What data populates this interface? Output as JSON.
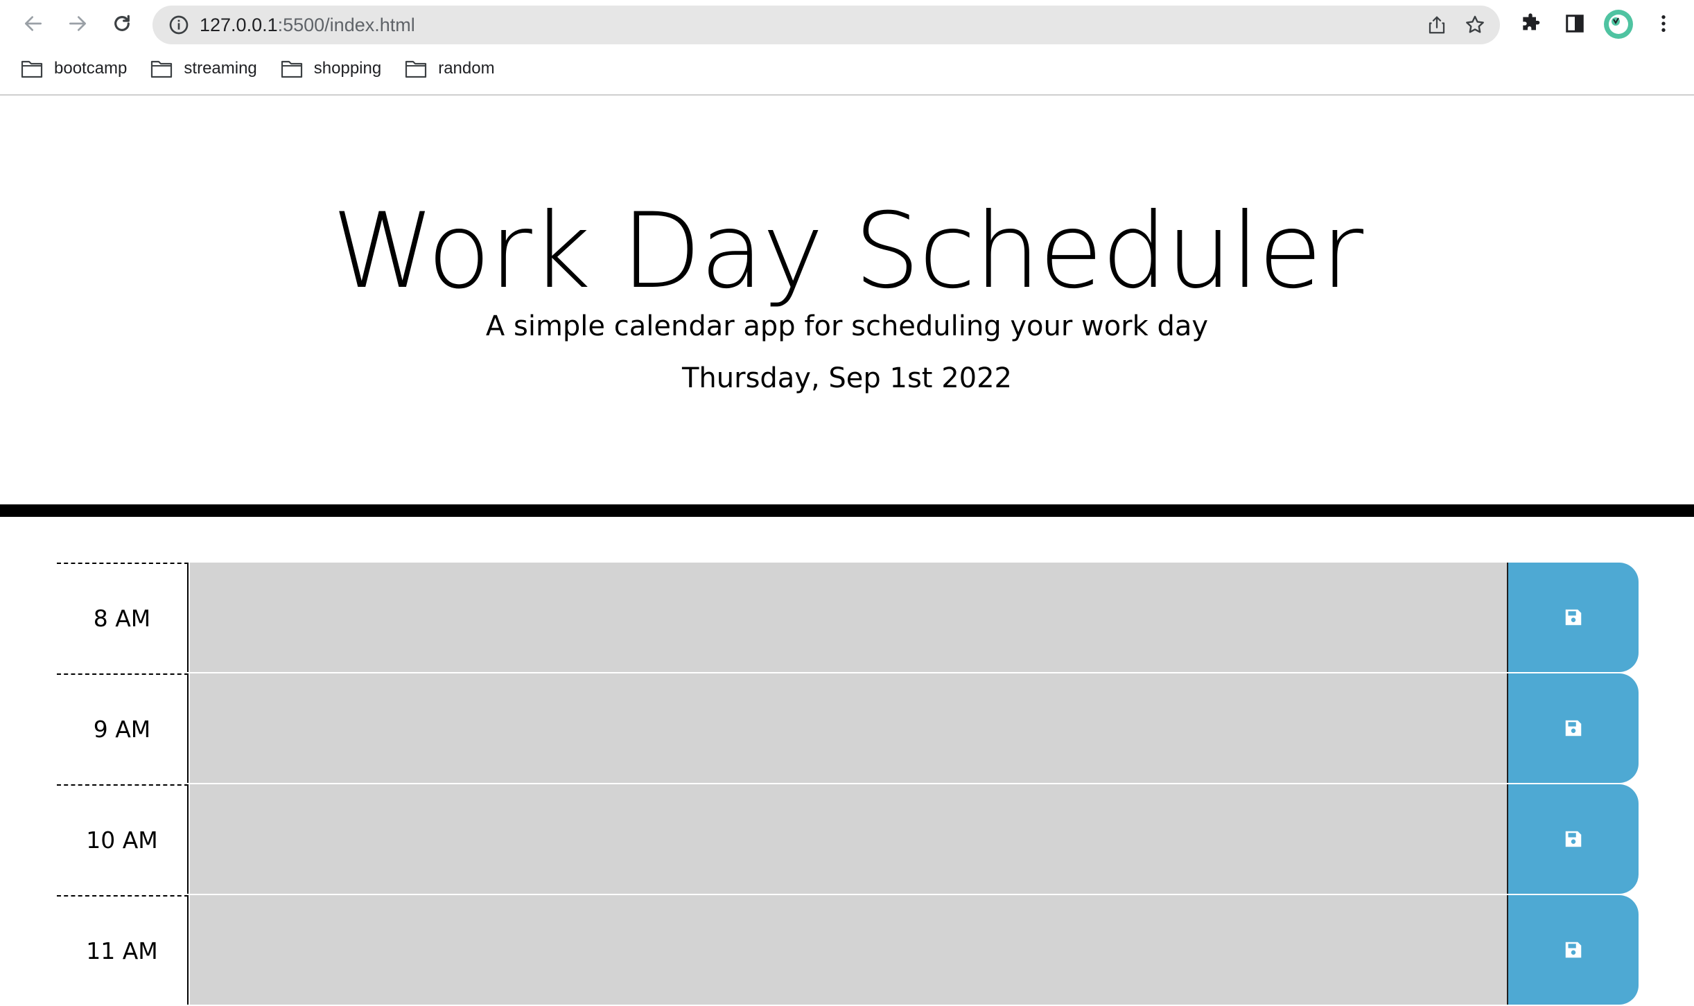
{
  "browser": {
    "url_host": "127.0.0.1",
    "url_rest": ":5500/index.html",
    "bookmarks": [
      {
        "label": "bootcamp"
      },
      {
        "label": "streaming"
      },
      {
        "label": "shopping"
      },
      {
        "label": "random"
      }
    ]
  },
  "header": {
    "title": "Work Day Scheduler",
    "lead": "A simple calendar app for scheduling your work day",
    "current_day": "Thursday, Sep 1st 2022"
  },
  "timeblocks": [
    {
      "hour": "8 AM",
      "text": ""
    },
    {
      "hour": "9 AM",
      "text": ""
    },
    {
      "hour": "10 AM",
      "text": ""
    },
    {
      "hour": "11 AM",
      "text": ""
    }
  ],
  "colors": {
    "past": "#d3d3d3",
    "save_button": "#4ea9d3",
    "divider": "#000000"
  }
}
